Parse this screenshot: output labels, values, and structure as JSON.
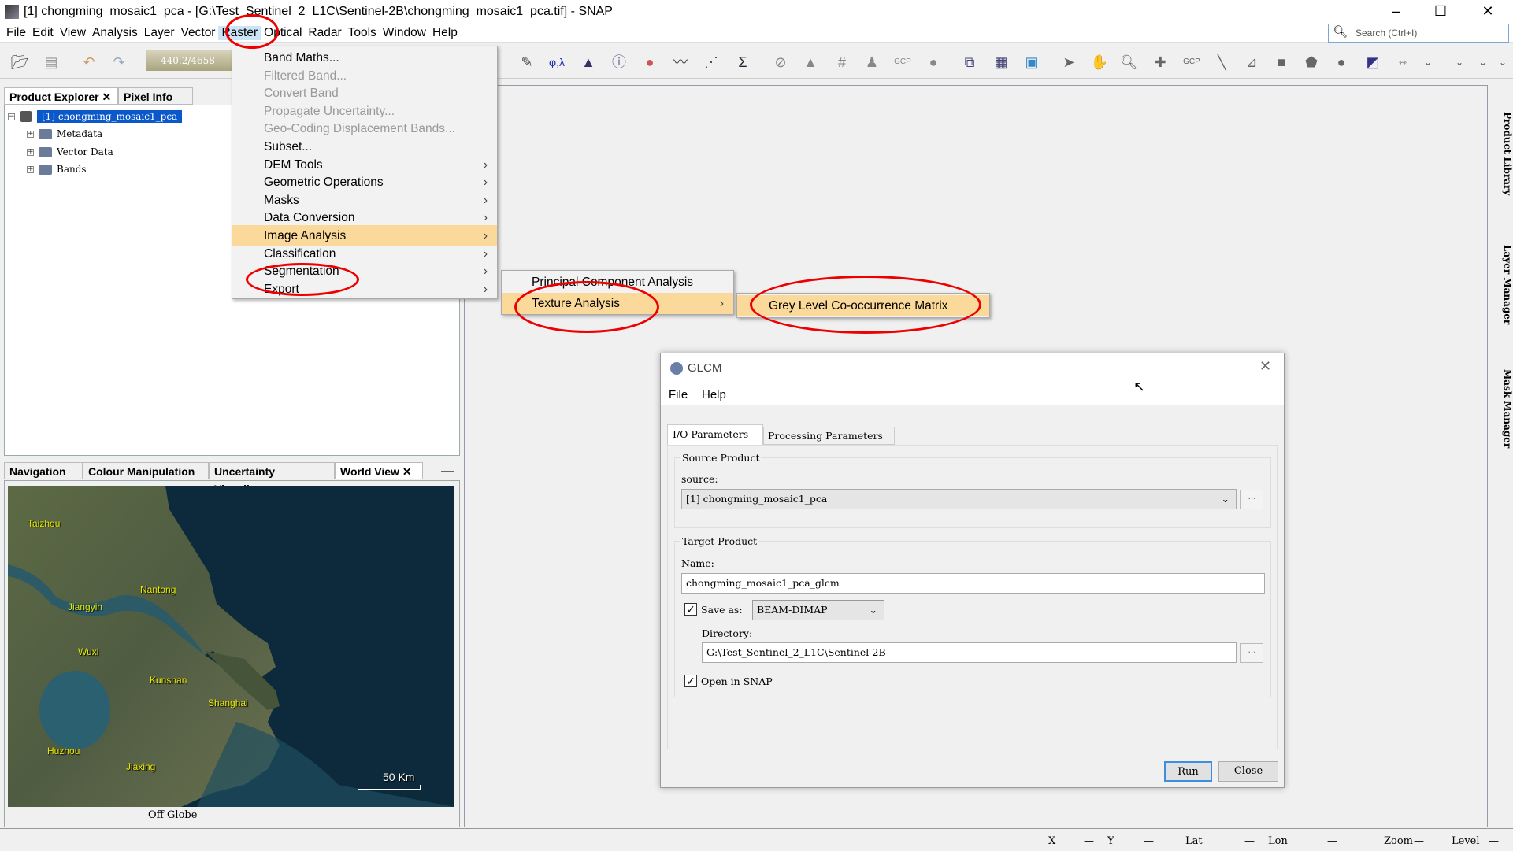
{
  "window": {
    "title": "[1] chongming_mosaic1_pca - [G:\\Test_Sentinel_2_L1C\\Sentinel-2B\\chongming_mosaic1_pca.tif] - SNAP"
  },
  "menubar": [
    "File",
    "Edit",
    "View",
    "Analysis",
    "Layer",
    "Vector",
    "Raster",
    "Optical",
    "Radar",
    "Tools",
    "Window",
    "Help"
  ],
  "search": {
    "placeholder": "Search (Ctrl+I)"
  },
  "toolbar": {
    "memory": "440.2/4658",
    "gcp1": "GCP",
    "gcp2": "GCP"
  },
  "explorer": {
    "tabs": [
      "Product Explorer",
      "Pixel Info"
    ],
    "product": "[1] chongming_mosaic1_pca",
    "nodes": [
      "Metadata",
      "Vector Data",
      "Bands"
    ]
  },
  "bottom_panel": {
    "tabs": [
      "Navigation",
      "Colour Manipulation",
      "Uncertainty Visualis···",
      "World View"
    ],
    "cities": [
      "Taizhou",
      "Nantong",
      "Jiangyin",
      "Wuxi",
      "Kunshan",
      "Shanghai",
      "Huzhou",
      "Jiaxing"
    ],
    "scale": "50 Km",
    "status": "Off Globe"
  },
  "raster_menu": {
    "items": [
      {
        "label": "Band Maths...",
        "enabled": true,
        "submenu": false
      },
      {
        "label": "Filtered Band...",
        "enabled": false,
        "submenu": false
      },
      {
        "label": "Convert Band",
        "enabled": false,
        "submenu": false
      },
      {
        "label": "Propagate Uncertainty...",
        "enabled": false,
        "submenu": false
      },
      {
        "label": "Geo-Coding Displacement Bands...",
        "enabled": false,
        "submenu": false
      },
      {
        "label": "Subset...",
        "enabled": true,
        "submenu": false
      },
      {
        "label": "DEM Tools",
        "enabled": true,
        "submenu": true
      },
      {
        "label": "Geometric Operations",
        "enabled": true,
        "submenu": true
      },
      {
        "label": "Masks",
        "enabled": true,
        "submenu": true
      },
      {
        "label": "Data Conversion",
        "enabled": true,
        "submenu": true
      },
      {
        "label": "Image Analysis",
        "enabled": true,
        "submenu": true
      },
      {
        "label": "Classification",
        "enabled": true,
        "submenu": true
      },
      {
        "label": "Segmentation",
        "enabled": true,
        "submenu": true
      },
      {
        "label": "Export",
        "enabled": true,
        "submenu": true
      }
    ],
    "image_analysis": [
      "Principal Component Analysis",
      "Texture Analysis"
    ],
    "texture_analysis": [
      "Grey Level Co-occurrence Matrix"
    ]
  },
  "dialog": {
    "title": "GLCM",
    "menu": [
      "File",
      "Help"
    ],
    "tabs": [
      "I/O Parameters",
      "Processing Parameters"
    ],
    "source_group": "Source Product",
    "source_label": "source:",
    "source_value": "[1] chongming_mosaic1_pca",
    "target_group": "Target Product",
    "name_label": "Name:",
    "name_value": "chongming_mosaic1_pca_glcm",
    "save_as_label": "Save as:",
    "save_as_checked": true,
    "format": "BEAM-DIMAP",
    "directory_label": "Directory:",
    "directory_value": "G:\\Test_Sentinel_2_L1C\\Sentinel-2B",
    "open_label": "Open in SNAP",
    "open_checked": true,
    "browse": "...",
    "run": "Run",
    "close": "Close"
  },
  "right_sidebar": [
    "Product Library",
    "Layer Manager",
    "Mask Manager"
  ],
  "statusbar": {
    "x": "X",
    "y": "Y",
    "lat": "Lat",
    "lon": "Lon",
    "zoom": "Zoom",
    "level": "Level",
    "dash": "—"
  },
  "colors": {
    "highlight": "#fbd99a",
    "annotation": "#e00000",
    "selection": "#0a58ca"
  }
}
